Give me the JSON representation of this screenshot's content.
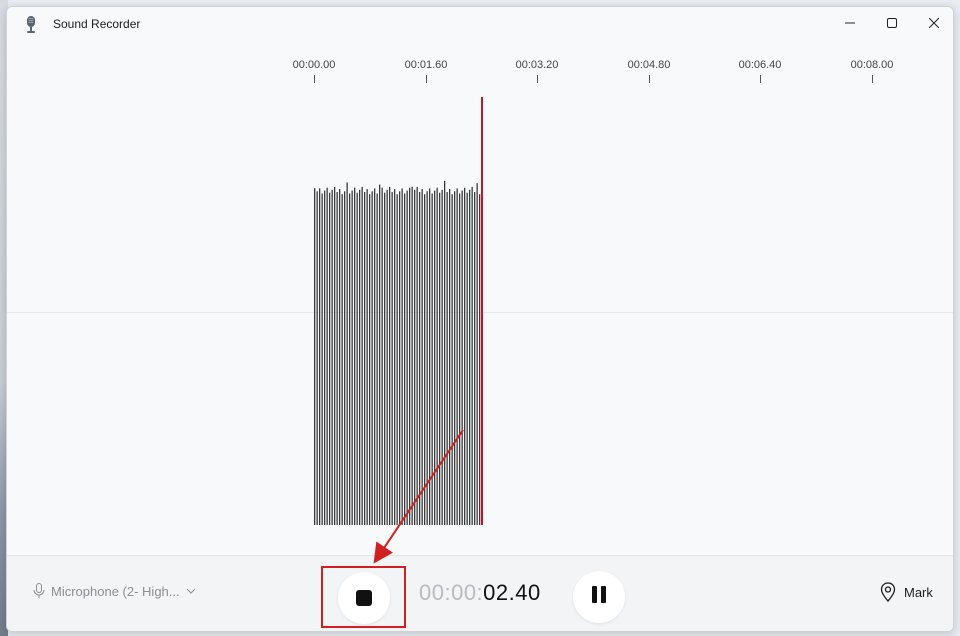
{
  "window": {
    "title": "Sound Recorder",
    "app_icon": "microphone-icon"
  },
  "window_controls": {
    "minimize": "minimize-icon",
    "maximize": "maximize-icon",
    "close": "close-icon"
  },
  "timeline": {
    "ticks": [
      "00:00.00",
      "00:01.60",
      "00:03.20",
      "00:04.80",
      "00:06.40",
      "00:08.00"
    ]
  },
  "recording": {
    "timer_dim": "00:00:",
    "timer_main": "02.40",
    "elapsed_seconds": 2.4,
    "level": 0.9
  },
  "bottom_bar": {
    "microphone_label": "Microphone (2- High...",
    "microphone_icon": "microphone-icon",
    "stop_icon": "stop-icon",
    "pause_icon": "pause-icon",
    "mark_label": "Mark",
    "mark_icon": "location-pin-icon"
  },
  "annotation": {
    "color": "#d21f1f"
  },
  "colors": {
    "playhead": "#c8102e",
    "waveform": "#3a3a3a"
  }
}
